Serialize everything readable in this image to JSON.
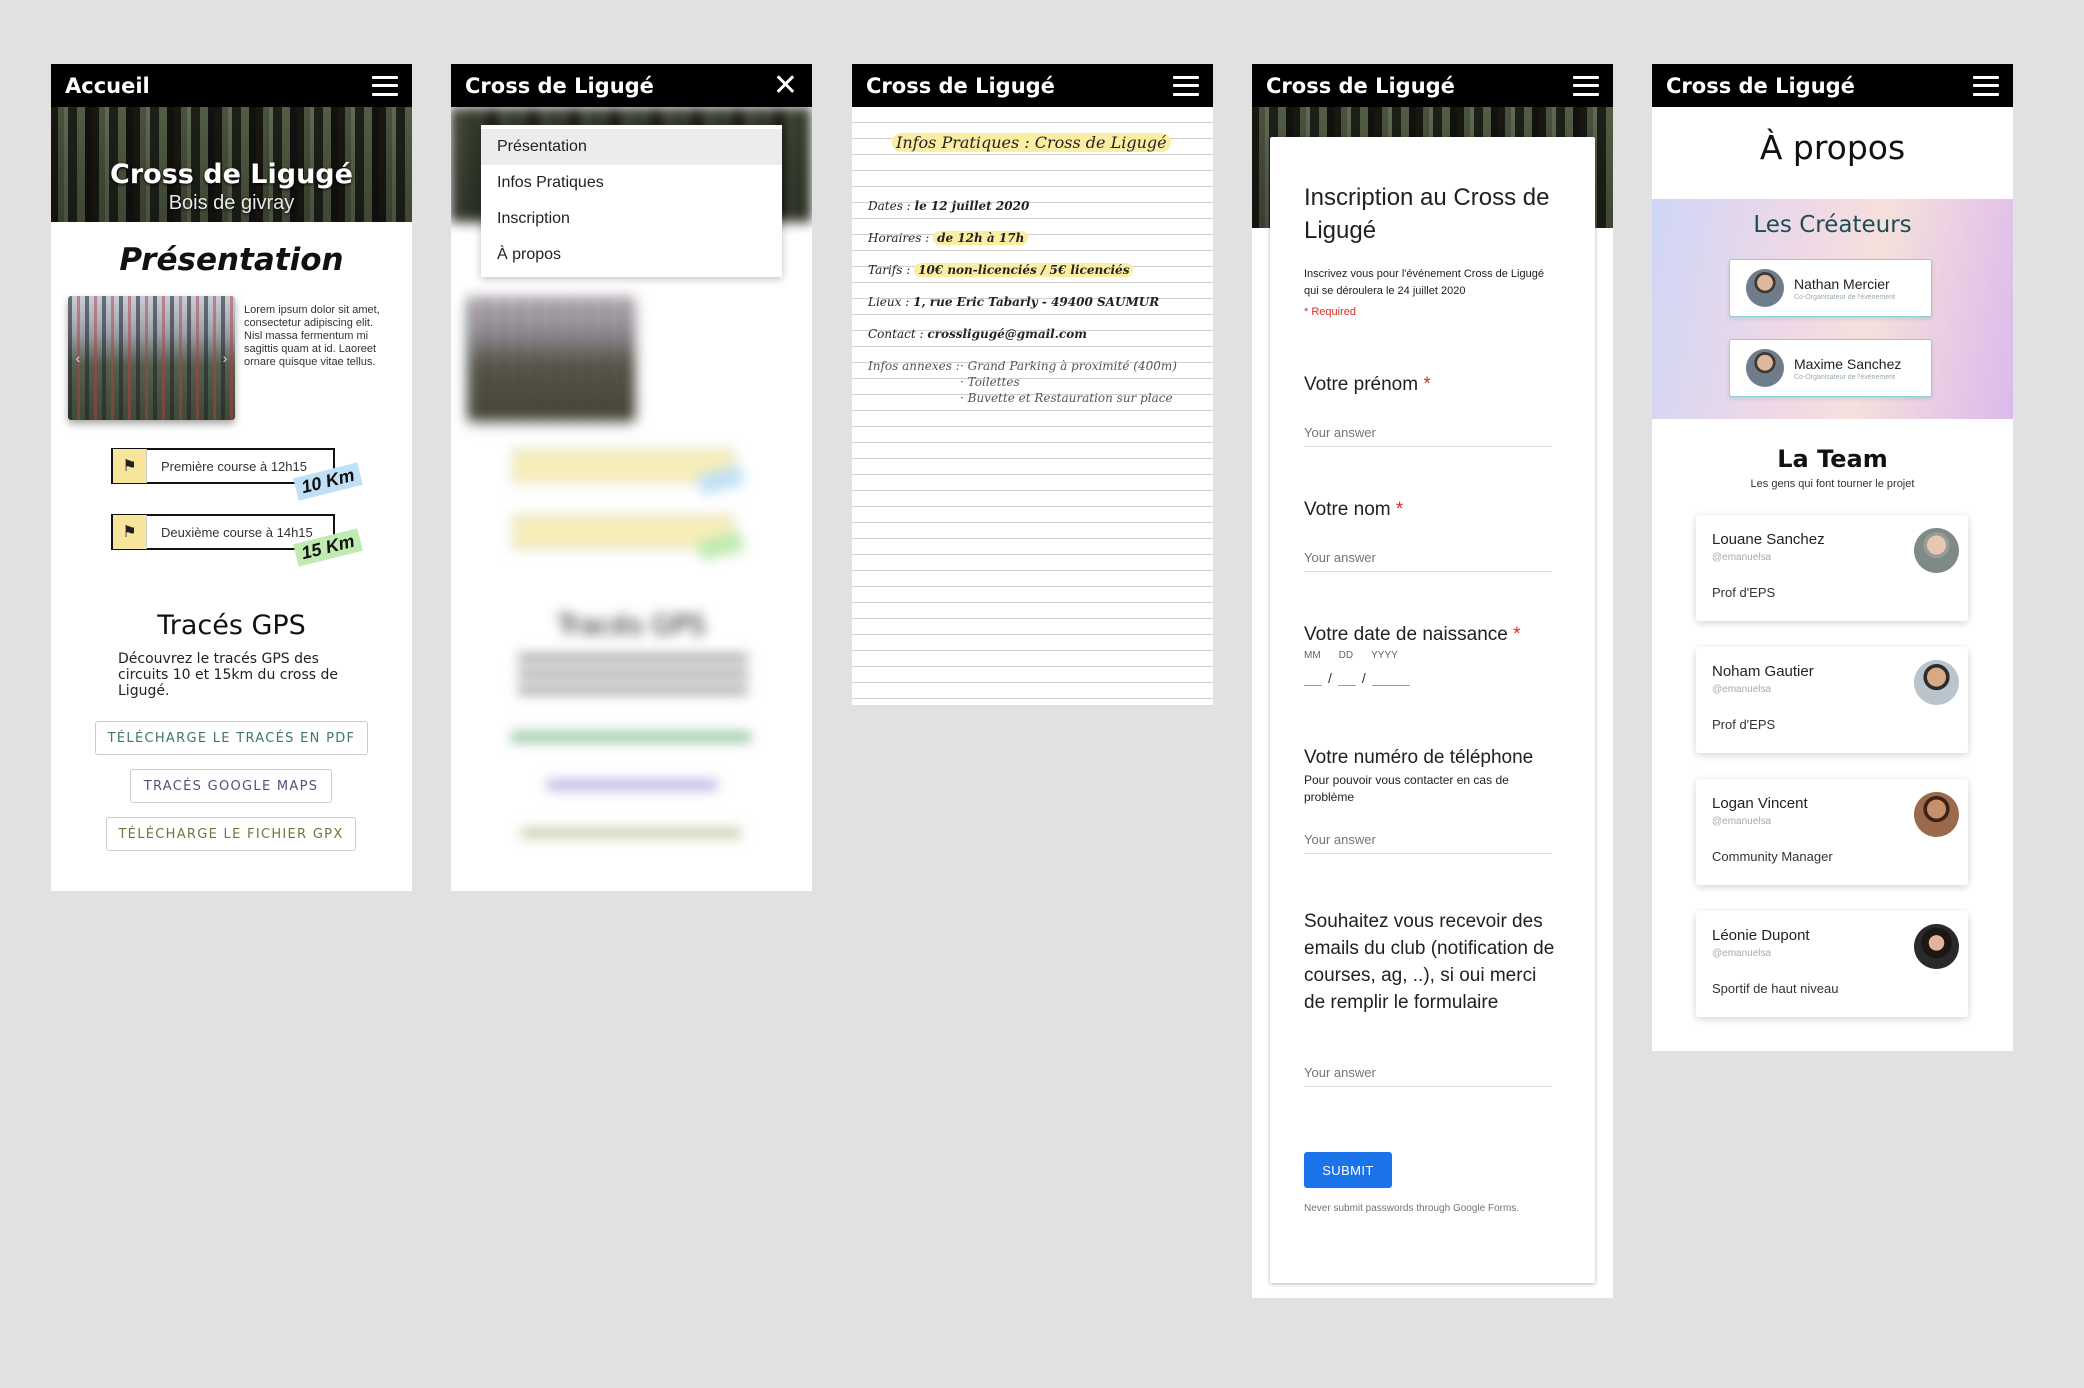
{
  "screen1": {
    "topbar_title": "Accueil",
    "hero_title": "Cross de Ligugé",
    "hero_subtitle": "Bois de givray",
    "section_title": "Présentation",
    "lorem": "Lorem ipsum dolor sit amet, consectetur adipiscing elit. Nisl massa fermentum mi sagittis quam at id. Laoreet ornare quisque vitae tellus.",
    "races": [
      {
        "label": "Première course à 12h15",
        "distance": "10 Km",
        "tag_color": "#bfe0f6"
      },
      {
        "label": "Deuxième course à 14h15",
        "distance": "15 Km",
        "tag_color": "#bfeab0"
      }
    ],
    "gps_title": "Tracés GPS",
    "gps_desc": "Découvrez le tracés GPS des circuits 10 et 15km du cross de Ligugé.",
    "buttons": [
      {
        "label": "TÉLÉCHARGE LE TRACÉS EN PDF",
        "color": "#3d7a5a"
      },
      {
        "label": "TRACÉS GOOGLE MAPS",
        "color": "#5a4f7a"
      },
      {
        "label": "TÉLÉCHARGE LE FICHIER GPX",
        "color": "#6a7a3a"
      }
    ]
  },
  "screen2": {
    "topbar_title": "Cross de Ligugé",
    "menu": [
      "Présentation",
      "Infos Pratiques",
      "Inscription",
      "À propos"
    ],
    "blurred_gps_title": "Tracés GPS"
  },
  "screen3": {
    "topbar_title": "Cross de Ligugé",
    "heading": "Infos Pratiques : Cross de Ligugé",
    "lines": [
      {
        "label": "Dates :",
        "value": "le 12 juillet 2020"
      },
      {
        "label": "Horaires :",
        "value": "de 12h à 17h"
      },
      {
        "label": "Tarifs :",
        "value": "10€ non-licenciés / 5€ licenciés"
      },
      {
        "label": "Lieux :",
        "value": "1, rue Eric Tabarly - 49400 SAUMUR"
      },
      {
        "label": "Contact :",
        "value": "crossligugé@gmail.com"
      }
    ],
    "annexes_label": "Infos annexes :",
    "annexes": [
      "· Grand Parking à proximité (400m)",
      "· Toilettes",
      "· Buvette et Restauration sur place"
    ]
  },
  "screen4": {
    "topbar_title": "Cross de Ligugé",
    "form_title": "Inscription au Cross de Ligugé",
    "form_desc": "Inscrivez vous pour l'événement Cross de Ligugé qui se déroulera le 24 juillet 2020",
    "required_note": "* Required",
    "q_prenom": "Votre prénom",
    "q_nom": "Votre nom",
    "q_naissance": "Votre date de naissance",
    "date_labels": [
      "MM",
      "DD",
      "YYYY"
    ],
    "q_tel": "Votre numéro de téléphone",
    "q_tel_sub": "Pour pouvoir vous contacter en cas de problème",
    "q_emails": "Souhaitez vous recevoir des emails du club (notification de courses, ag, ..), si oui merci de remplir le formulaire",
    "answer_placeholder": "Your answer",
    "star": "*",
    "submit": "SUBMIT",
    "footer": "Never submit passwords through Google Forms."
  },
  "screen5": {
    "topbar_title": "Cross de Ligugé",
    "title": "À propos",
    "creators_title": "Les Créateurs",
    "creators": [
      {
        "name": "Nathan Mercier",
        "role": "Co-Organisateur de l'événement"
      },
      {
        "name": "Maxime Sanchez",
        "role": "Co-Organisateur de l'événement"
      }
    ],
    "team_title": "La Team",
    "team_subtitle": "Les gens qui font tourner le projet",
    "team": [
      {
        "name": "Louane Sanchez",
        "handle": "@emanuelsa",
        "role": "Prof d'EPS"
      },
      {
        "name": "Noham Gautier",
        "handle": "@emanuelsa",
        "role": "Prof d'EPS"
      },
      {
        "name": "Logan Vincent",
        "handle": "@emanuelsa",
        "role": "Community Manager"
      },
      {
        "name": "Léonie Dupont",
        "handle": "@emanuelsa",
        "role": "Sportif de haut niveau"
      }
    ]
  },
  "colors": {
    "background": "#e1e1e1",
    "topbar": "#000000",
    "submit": "#1a73e8",
    "required": "#d93025",
    "highlight": "#fbeea2"
  }
}
